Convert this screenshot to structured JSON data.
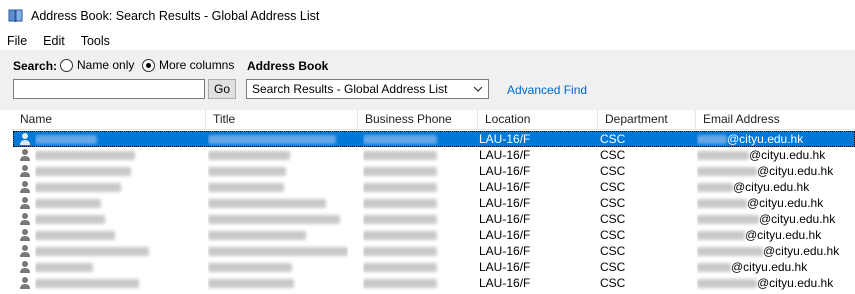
{
  "window": {
    "title": "Address Book: Search Results - Global Address List",
    "icon": "address-book-icon"
  },
  "menu": [
    "File",
    "Edit",
    "Tools"
  ],
  "search": {
    "label": "Search:",
    "radio_name_only": "Name only",
    "radio_more_columns": "More columns",
    "selected_mode": "More columns",
    "input_value": "",
    "go_label": "Go"
  },
  "address_book": {
    "label": "Address Book",
    "selected": "Search Results - Global Address List",
    "advanced_find": "Advanced Find"
  },
  "columns": [
    "Name",
    "Title",
    "Business Phone",
    "Location",
    "Department",
    "Email Address"
  ],
  "rows": [
    {
      "location": "LAU-16/F",
      "department": "CSC",
      "email_domain": "@cityu.edu.hk",
      "selected": true
    },
    {
      "location": "LAU-16/F",
      "department": "CSC",
      "email_domain": "@cityu.edu.hk",
      "selected": false
    },
    {
      "location": "LAU-16/F",
      "department": "CSC",
      "email_domain": "@cityu.edu.hk",
      "selected": false
    },
    {
      "location": "LAU-16/F",
      "department": "CSC",
      "email_domain": "@cityu.edu.hk",
      "selected": false
    },
    {
      "location": "LAU-16/F",
      "department": "CSC",
      "email_domain": "@cityu.edu.hk",
      "selected": false
    },
    {
      "location": "LAU-16/F",
      "department": "CSC",
      "email_domain": "@cityu.edu.hk",
      "selected": false
    },
    {
      "location": "LAU-16/F",
      "department": "CSC",
      "email_domain": "@cityu.edu.hk",
      "selected": false
    },
    {
      "location": "LAU-16/F",
      "department": "CSC",
      "email_domain": "@cityu.edu.hk",
      "selected": false
    },
    {
      "location": "LAU-16/F",
      "department": "CSC",
      "email_domain": "@cityu.edu.hk",
      "selected": false
    },
    {
      "location": "LAU-16/F",
      "department": "CSC",
      "email_domain": "@cityu.edu.hk",
      "selected": false
    }
  ],
  "colors": {
    "selection": "#0078d7",
    "link": "#0066cc",
    "toolbar_bg": "#f0f0f0"
  }
}
